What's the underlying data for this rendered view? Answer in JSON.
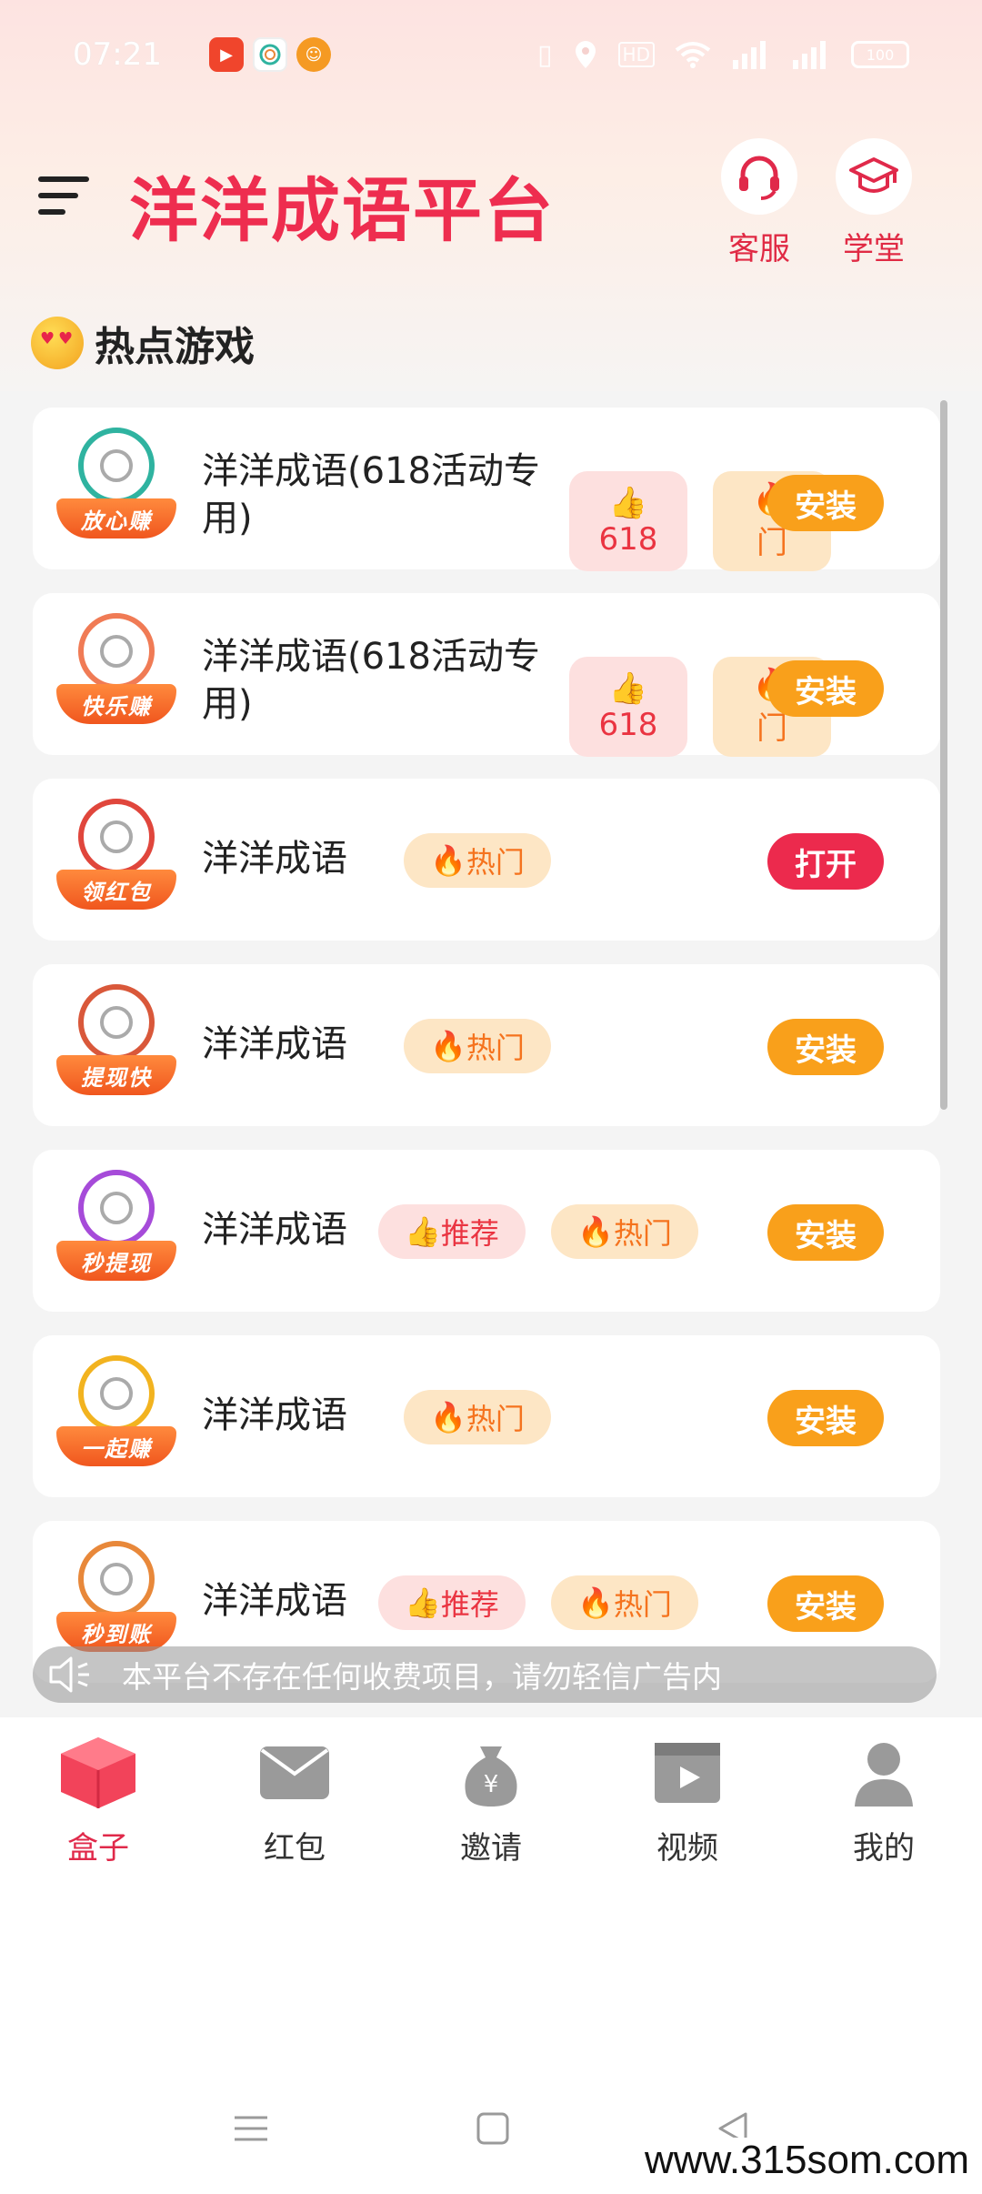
{
  "status_bar": {
    "time": "07:21",
    "battery": "100",
    "icons": [
      "video-app-icon",
      "yy-app-icon",
      "bot-app-icon",
      "vibrate-icon",
      "location-icon",
      "hd-icon",
      "wifi-icon",
      "signal-icon",
      "signal-icon"
    ]
  },
  "header": {
    "title": "洋洋成语平台",
    "service_label": "客服",
    "academy_label": "学堂"
  },
  "section": {
    "title": "热点游戏"
  },
  "games": [
    {
      "badge": "放心赚",
      "name_line1": "洋洋成语(618活动专",
      "name_line2": "用)",
      "rec_tag": "618",
      "hot_tag": "门",
      "button": "安装",
      "ring": "#2fb3a0"
    },
    {
      "badge": "快乐赚",
      "name_line1": "洋洋成语(618活动专",
      "name_line2": "用)",
      "rec_tag": "618",
      "hot_tag": "门",
      "button": "安装",
      "ring": "#f07b55"
    },
    {
      "badge": "领红包",
      "name": "洋洋成语",
      "hot_tag": "热门",
      "button": "打开",
      "ring": "#e0463c"
    },
    {
      "badge": "提现快",
      "name": "洋洋成语",
      "hot_tag": "热门",
      "button": "安装",
      "ring": "#d9583a"
    },
    {
      "badge": "秒提现",
      "name": "洋洋成语",
      "rec_tag": "推荐",
      "hot_tag": "热门",
      "button": "安装",
      "ring": "#a64bd9"
    },
    {
      "badge": "一起赚",
      "name": "洋洋成语",
      "hot_tag": "热门",
      "button": "安装",
      "ring": "#f2b31f"
    },
    {
      "badge": "秒到账",
      "name": "洋洋成语",
      "rec_tag": "推荐",
      "hot_tag": "热门",
      "button": "安装",
      "ring": "#e8883a"
    }
  ],
  "notice": {
    "text": "本平台不存在任何收费项目，请勿轻信广告内"
  },
  "tabs": [
    {
      "label": "盒子",
      "icon": "box-icon",
      "active": true
    },
    {
      "label": "红包",
      "icon": "envelope-icon"
    },
    {
      "label": "邀请",
      "icon": "money-bag-icon"
    },
    {
      "label": "视频",
      "icon": "video-icon"
    },
    {
      "label": "我的",
      "icon": "user-icon"
    }
  ],
  "watermark": "www.315som.com",
  "colors": {
    "brand_red": "#ee2d4f",
    "install_orange": "#f9a01b",
    "open_red": "#ec2a4d",
    "hot_bg": "#fde6c5",
    "rec_bg": "#fde0df"
  }
}
